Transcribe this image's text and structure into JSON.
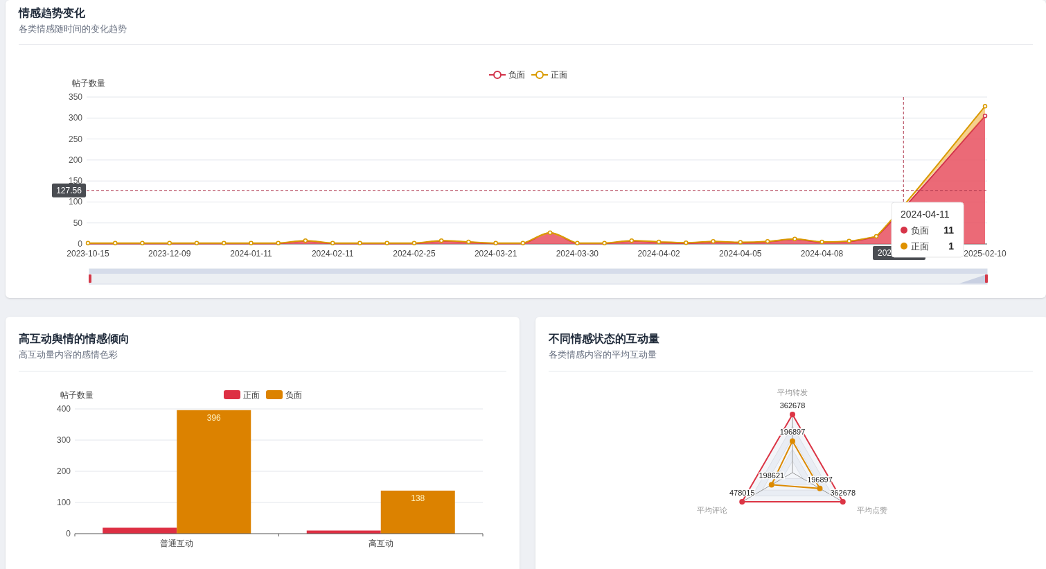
{
  "trend_card": {
    "title": "情感趋势变化",
    "subtitle": "各类情感随时间的变化趋势",
    "chart_data": {
      "type": "area",
      "ylabel": "帖子数量",
      "stacked": true,
      "ylim": [
        0,
        350
      ],
      "yticks": [
        0,
        50,
        100,
        150,
        200,
        250,
        300,
        350
      ],
      "grid": true,
      "legend": true,
      "ref_lines": [
        {
          "axis": "y",
          "value": 127.56
        }
      ],
      "categories": [
        "2023-10-15",
        null,
        null,
        "2023-12-09",
        null,
        null,
        "2024-01-11",
        null,
        null,
        "2024-02-11",
        null,
        null,
        "2024-02-25",
        null,
        null,
        "2024-03-21",
        null,
        null,
        "2024-03-30",
        null,
        null,
        "2024-04-02",
        null,
        null,
        "2024-04-05",
        null,
        null,
        "2024-04-08",
        null,
        null,
        null,
        null,
        null,
        "2025-02-10"
      ],
      "series": [
        {
          "name": "负面",
          "color": "#d2334a",
          "values": [
            1,
            1,
            1,
            1,
            1,
            1,
            1,
            1,
            7,
            1,
            1,
            1,
            1,
            7,
            4,
            1,
            1,
            26,
            1,
            1,
            7,
            4,
            2,
            5,
            3,
            5,
            11,
            4,
            6,
            17,
            null,
            null,
            null,
            305
          ]
        },
        {
          "name": "正面",
          "color": "#d99a00",
          "values": [
            1,
            1,
            1,
            1,
            1,
            1,
            1,
            1,
            1,
            1,
            1,
            1,
            1,
            1,
            1,
            1,
            1,
            1,
            1,
            1,
            1,
            1,
            1,
            1,
            1,
            1,
            1,
            1,
            1,
            1,
            null,
            null,
            null,
            23
          ]
        }
      ]
    },
    "crosshair": {
      "y_label": "127.56",
      "x_label": "202"
    },
    "tooltip": {
      "title": "2024-04-11",
      "rows": [
        {
          "name": "负面",
          "value": "11",
          "color": "#d63448"
        },
        {
          "name": "正面",
          "value": "1",
          "color": "#df9100"
        }
      ]
    }
  },
  "interaction_card": {
    "title": "高互动舆情的情感倾向",
    "subtitle": "高互动量内容的感情色彩",
    "chart_data": {
      "type": "bar",
      "ylabel": "帖子数量",
      "grid": true,
      "legend": true,
      "categories": [
        "普通互动",
        "高互动"
      ],
      "ylim": [
        0,
        400
      ],
      "yticks": [
        0,
        100,
        200,
        300,
        400
      ],
      "series": [
        {
          "name": "正面",
          "color": "#dd2f43",
          "values": [
            19,
            10
          ]
        },
        {
          "name": "负面",
          "color": "#dc8200",
          "values": [
            396,
            138
          ]
        }
      ]
    },
    "value_labels": [
      "396",
      "138"
    ]
  },
  "engagement_card": {
    "title": "不同情感状态的互动量",
    "subtitle": "各类情感内容的平均互动量",
    "radar": {
      "indicators": [
        "平均转发",
        "平均点赞",
        "平均评论"
      ],
      "series": [
        {
          "color": "#dc3545",
          "values": [
            "362678",
            "362678",
            "478015"
          ]
        },
        {
          "color": "#dc8a00",
          "values": [
            "196897",
            "196897",
            "198621"
          ]
        }
      ]
    }
  }
}
